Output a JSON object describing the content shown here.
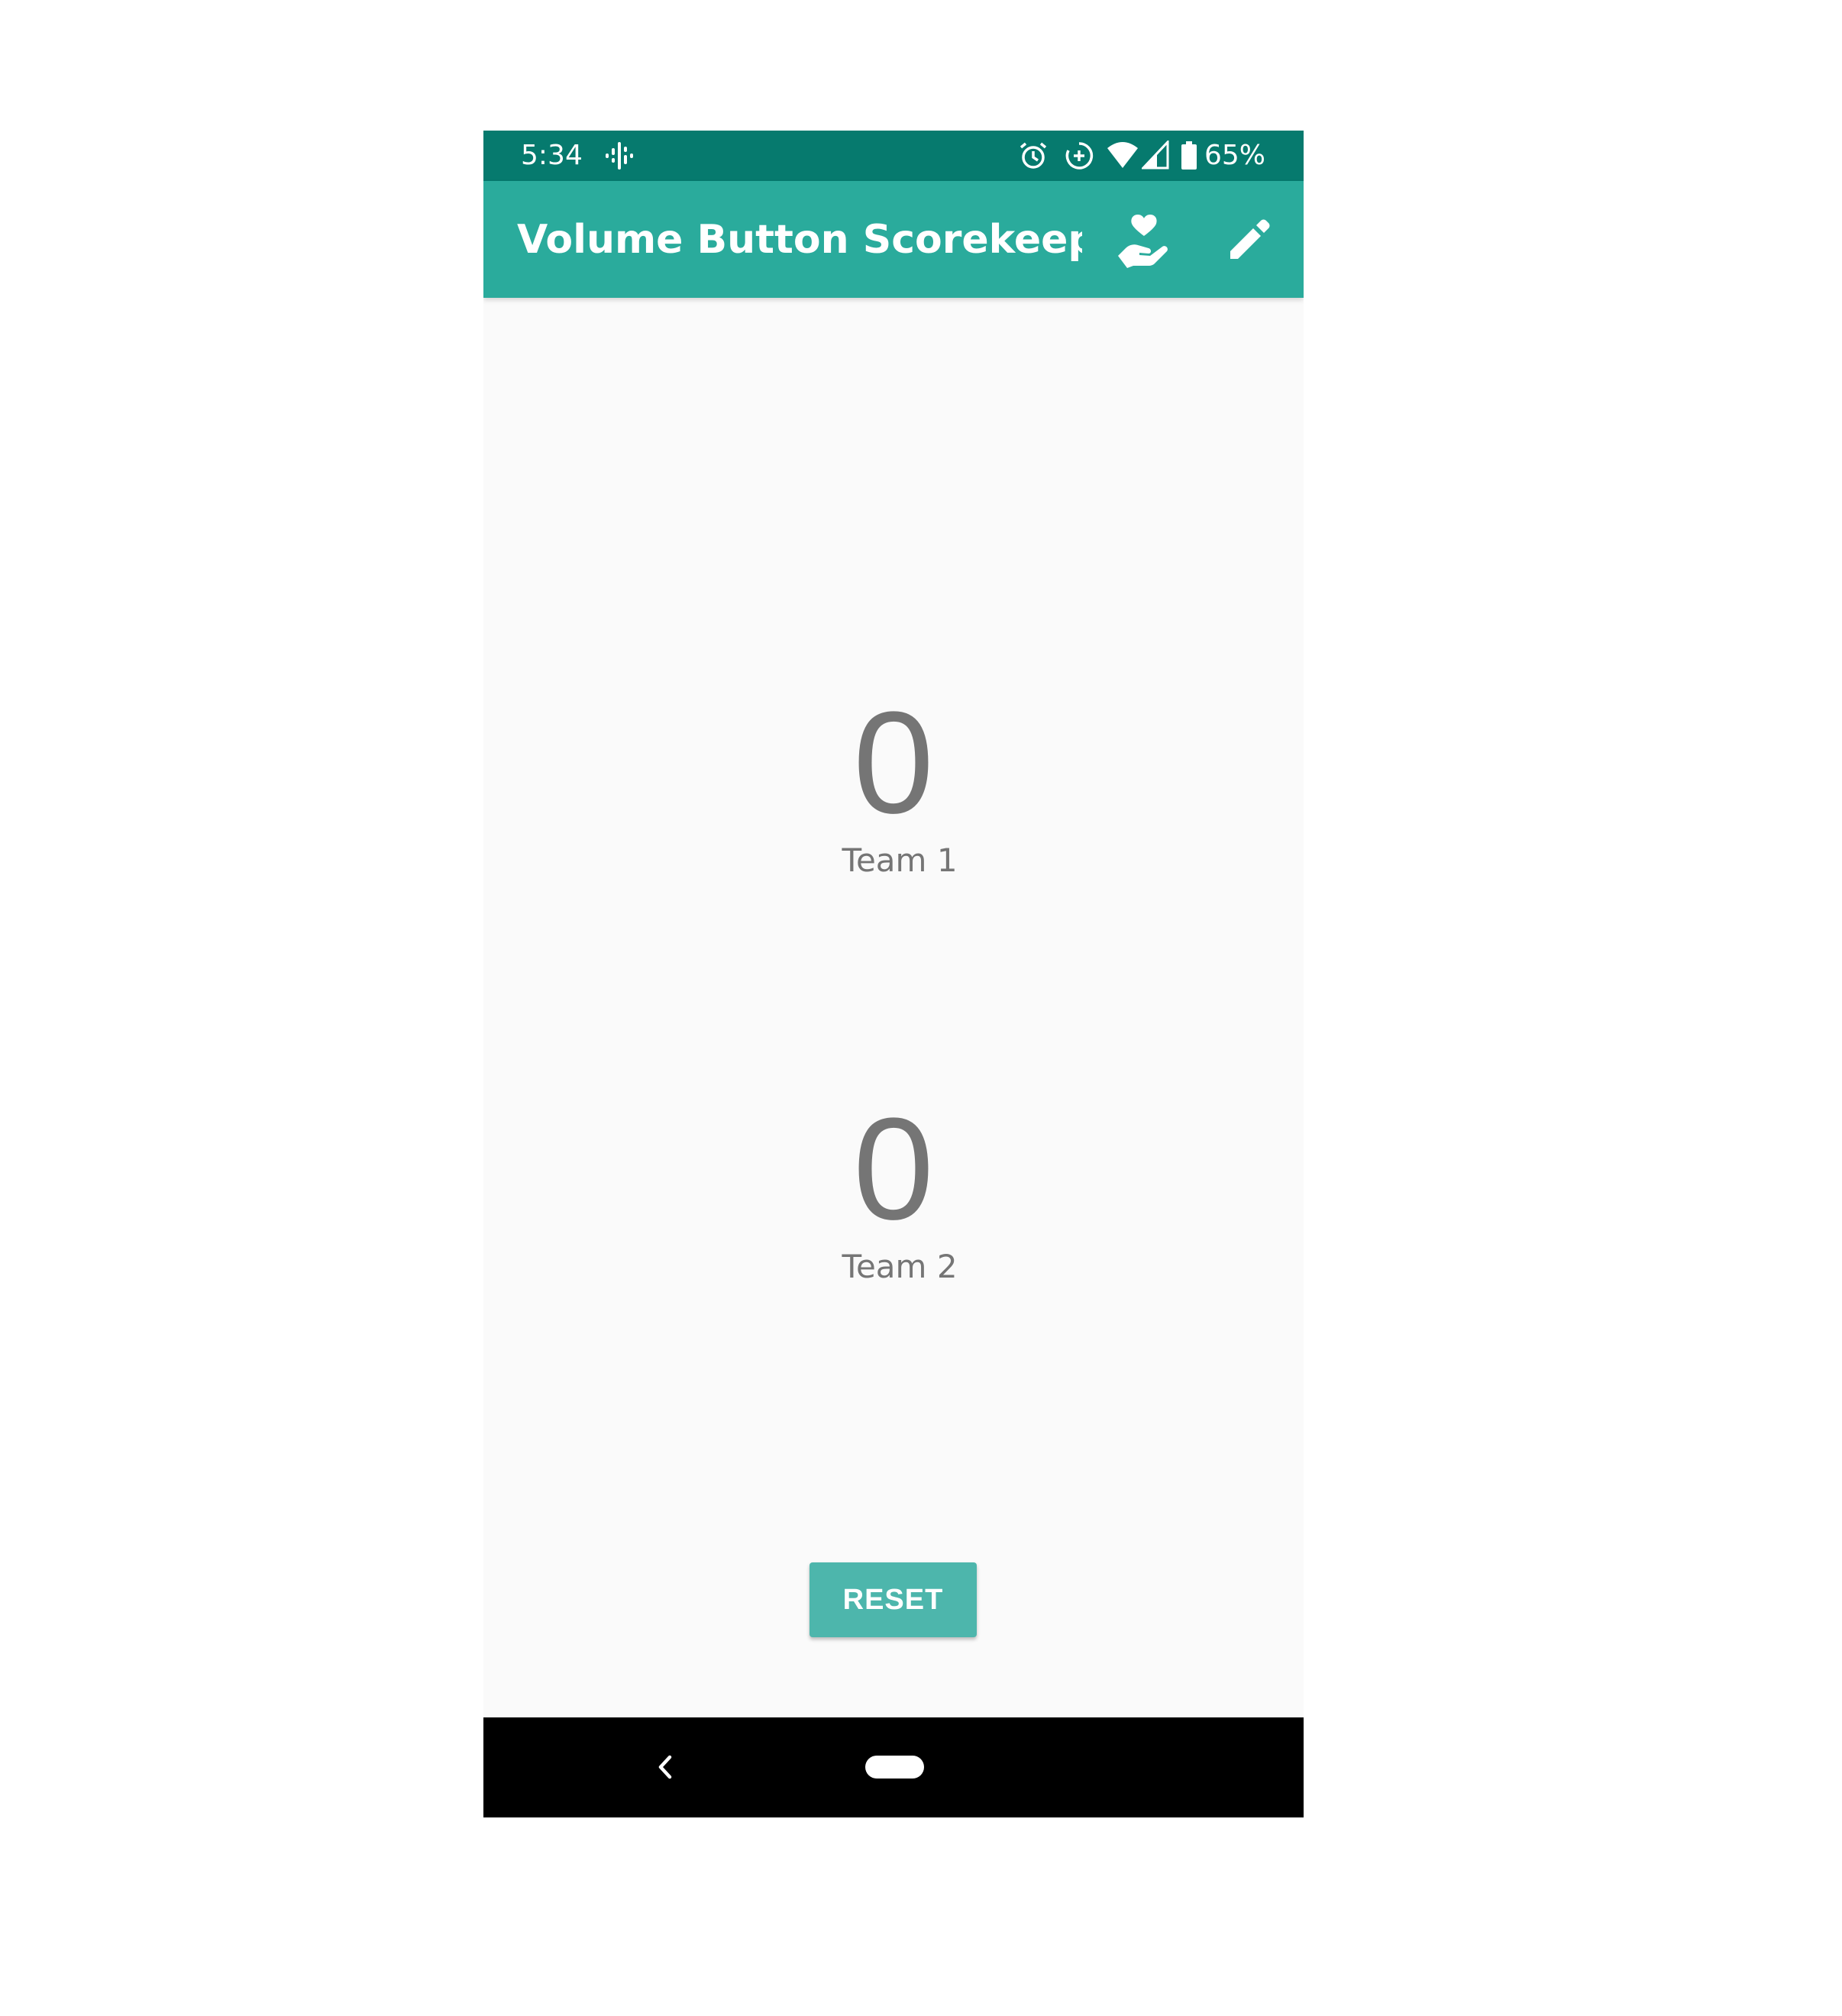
{
  "status_bar": {
    "time": "5:34",
    "battery": "65%",
    "icons": [
      "podcast-icon",
      "alarm-icon",
      "data-saver-icon",
      "wifi-icon",
      "signal-icon",
      "battery-icon"
    ]
  },
  "app_bar": {
    "title": "Volume Button Scorekeeper...",
    "actions": [
      "donate-heart-hand-icon",
      "edit-pencil-icon"
    ]
  },
  "scores": [
    {
      "value": "0",
      "team": "Team 1"
    },
    {
      "value": "0",
      "team": "Team 2"
    }
  ],
  "reset_label": "RESET",
  "colors": {
    "status_bar": "#067a6e",
    "app_bar": "#2aab9c",
    "button": "#4db6ac",
    "text": "#757575",
    "background": "#fafafa"
  }
}
